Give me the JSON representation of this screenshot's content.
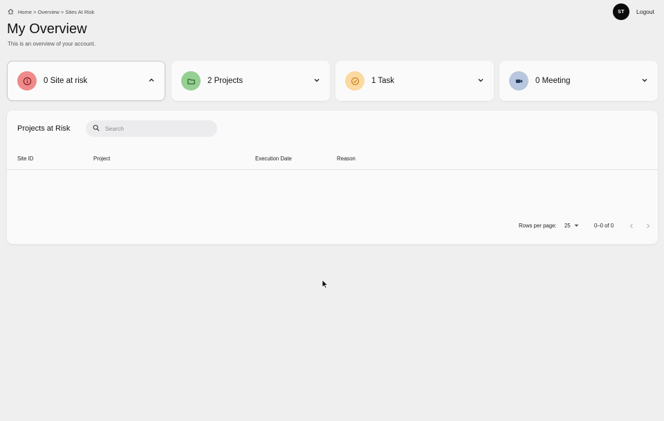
{
  "breadcrumb": {
    "icon": "home-icon",
    "text": "Home > Overview > Sites At Risk"
  },
  "user": {
    "initials": "ST",
    "logout_label": "Logout"
  },
  "header": {
    "title": "My Overview",
    "subtitle": "This is an overview of your account."
  },
  "cards": [
    {
      "label": "0 Site at risk",
      "icon": "info-icon",
      "color": "#f08a8a",
      "chevron": "chevron-up-icon",
      "active": true
    },
    {
      "label": "2 Projects",
      "icon": "folder-icon",
      "color": "#96cf92",
      "chevron": "chevron-down-icon",
      "active": false
    },
    {
      "label": "1 Task",
      "icon": "check-circle-icon",
      "color": "#fcd9a0",
      "chevron": "chevron-down-icon",
      "active": false
    },
    {
      "label": "0 Meeting",
      "icon": "video-icon",
      "color": "#b8c7dd",
      "chevron": "chevron-down-icon",
      "active": false
    }
  ],
  "table": {
    "title": "Projects at Risk",
    "search_placeholder": "Search",
    "columns": [
      "Site ID",
      "Project",
      "Execution Date",
      "Reason"
    ],
    "rows": [],
    "rows_per_page_label": "Rows per page:",
    "rows_per_page_value": "25",
    "range_text": "0–0 of 0"
  },
  "colors": {
    "background": "#efefef",
    "panel": "#fafafa",
    "avatar": "#0b0b0b"
  }
}
